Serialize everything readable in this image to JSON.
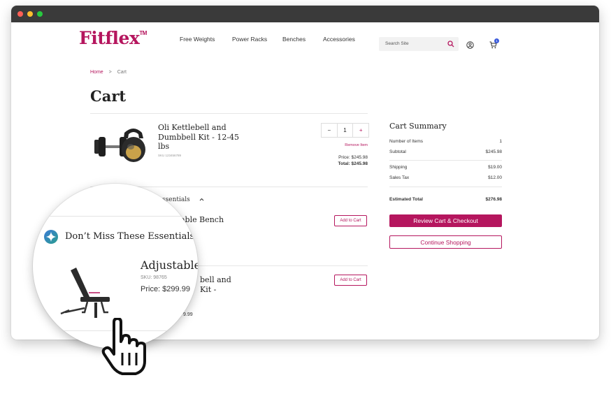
{
  "brand": {
    "name": "Fitflex",
    "tm": "TM",
    "accent": "#b5165e"
  },
  "nav": [
    "Free Weights",
    "Power Racks",
    "Benches",
    "Accessories"
  ],
  "search": {
    "placeholder": "Search Site",
    "icon": "search-icon"
  },
  "header_icons": {
    "account": "user-icon",
    "cart": "cart-icon",
    "cart_count": "1"
  },
  "breadcrumb": {
    "home": "Home",
    "separator": ">",
    "current": "Cart"
  },
  "page_title": "Cart",
  "cart_item": {
    "title": "Oli Kettlebell and Dumbbell Kit - 12-45 lbs",
    "sku": "SKU 123456789",
    "quantity": "1",
    "minus": "−",
    "plus": "+",
    "remove": "Remove Item",
    "price": "Price: $245.98",
    "total": "Total: $245.98",
    "image": "kettlebell-dumbbell-image"
  },
  "essentials": {
    "title": "Don’t Miss These Essentials",
    "title_partial": "ssentials",
    "items": [
      {
        "title": "Adjustable Bench",
        "partial": "able Bench",
        "sku": "SKU: 98765",
        "price": "Price: $299.99",
        "add": "Add to Cart"
      },
      {
        "partial_line1": "bell and",
        "partial_line2": "Kit -",
        "partial_price": "9.99",
        "add": "Add to Cart"
      }
    ]
  },
  "summary": {
    "title": "Cart Summary",
    "rows": [
      {
        "label": "Number of Items",
        "value": "1"
      },
      {
        "label": "Subtotal",
        "value": "$245.98"
      },
      {
        "label": "Shipping",
        "value": "$19.00"
      },
      {
        "label": "Sales Tax",
        "value": "$12.00"
      }
    ],
    "estimated": {
      "label": "Estimated Total",
      "value": "$276.98"
    },
    "checkout": "Review Cart & Checkout",
    "continue": "Continue Shopping"
  }
}
